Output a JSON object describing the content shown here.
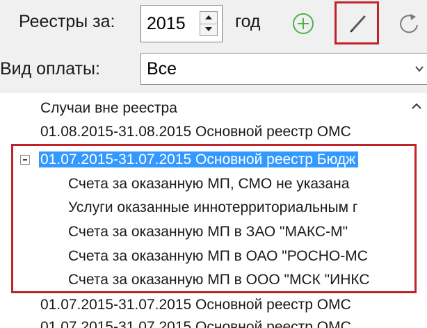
{
  "toolbar": {
    "registries_label": "Реестры за:",
    "year_value": "2015",
    "year_unit": "год",
    "add_icon": "plus-circle-icon",
    "edit_icon": "pencil-icon",
    "refresh_icon": "refresh-icon"
  },
  "payment": {
    "label": "Вид оплаты:",
    "value": "Все"
  },
  "tree": {
    "items": [
      {
        "text": "Случаи вне реестра"
      },
      {
        "text": "01.08.2015-31.08.2015 Основной реестр ОМС"
      },
      {
        "text": "01.07.2015-31.07.2015 Основной реестр Бюдж"
      },
      {
        "text": "Счета за оказанную МП, СМО не указана"
      },
      {
        "text": "Услуги оказанные иннотерриториальным г"
      },
      {
        "text": "Счета за оказанную МП в ЗАО \"МАКС-М\""
      },
      {
        "text": "Счета за оказанную МП в ОАО \"РОСНО-МС"
      },
      {
        "text": "Счета за оказанную МП в ООО \"МСК \"ИНКС"
      },
      {
        "text": "01.07.2015-31.07.2015 Основной реестр ОМС"
      },
      {
        "text": "01.07.2015-31.07.2015 Основной реестр ОМС"
      }
    ]
  },
  "colors": {
    "highlight": "#c0242b",
    "selection": "#3399ff",
    "add_icon": "#4caf50"
  }
}
